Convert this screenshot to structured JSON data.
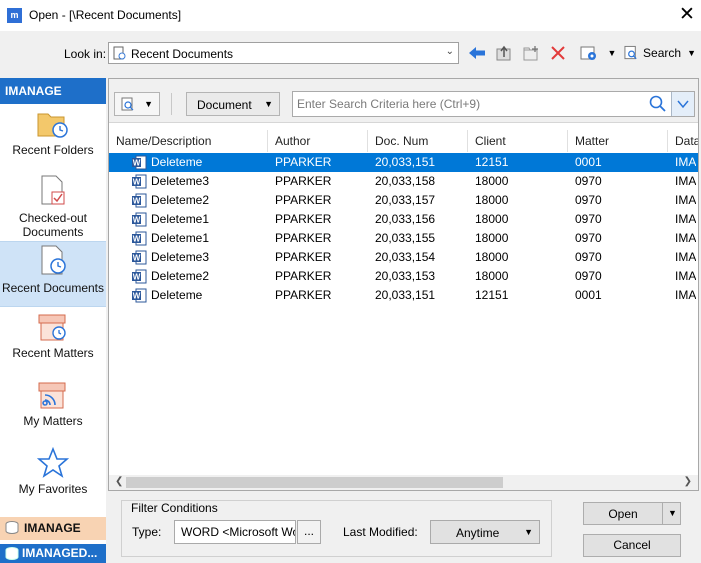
{
  "window": {
    "title": "Open - [\\Recent Documents]",
    "app_icon": "m",
    "close_glyph": "✕"
  },
  "toolbar": {
    "look_in_label": "Look in:",
    "look_in_value": "Recent Documents",
    "search_label": "Search",
    "icons": [
      "back-arrow-icon",
      "up-folder-icon",
      "new-folder-icon",
      "delete-icon",
      "settings-icon",
      "search-page-icon"
    ]
  },
  "sidebar": {
    "header": "IMANAGE",
    "items": [
      {
        "label": "Recent Folders",
        "icon": "recent-folders-icon"
      },
      {
        "label": "Checked-out Documents",
        "icon": "checked-out-icon"
      },
      {
        "label": "Recent Documents",
        "icon": "recent-documents-icon",
        "selected": true
      },
      {
        "label": "Recent Matters",
        "icon": "recent-matters-icon"
      },
      {
        "label": "My Matters",
        "icon": "my-matters-icon"
      },
      {
        "label": "My Favorites",
        "icon": "star-icon"
      }
    ],
    "footer": [
      "IMANAGE",
      "IMANAGED..."
    ]
  },
  "filterbar": {
    "doc_type": "Document",
    "search_placeholder": "Enter Search Criteria here (Ctrl+9)"
  },
  "table": {
    "columns": [
      "Name/Description",
      "Author",
      "Doc. Num",
      "Client",
      "Matter",
      "Data"
    ],
    "rows": [
      {
        "name": "Deleteme",
        "author": "PPARKER",
        "docnum": "20,033,151",
        "client": "12151",
        "matter": "0001",
        "data": "IMA"
      },
      {
        "name": "Deleteme3",
        "author": "PPARKER",
        "docnum": "20,033,158",
        "client": "18000",
        "matter": "0970",
        "data": "IMA"
      },
      {
        "name": "Deleteme2",
        "author": "PPARKER",
        "docnum": "20,033,157",
        "client": "18000",
        "matter": "0970",
        "data": "IMA"
      },
      {
        "name": "Deleteme1",
        "author": "PPARKER",
        "docnum": "20,033,156",
        "client": "18000",
        "matter": "0970",
        "data": "IMA"
      },
      {
        "name": "Deleteme1",
        "author": "PPARKER",
        "docnum": "20,033,155",
        "client": "18000",
        "matter": "0970",
        "data": "IMA"
      },
      {
        "name": "Deleteme3",
        "author": "PPARKER",
        "docnum": "20,033,154",
        "client": "18000",
        "matter": "0970",
        "data": "IMA"
      },
      {
        "name": "Deleteme2",
        "author": "PPARKER",
        "docnum": "20,033,153",
        "client": "18000",
        "matter": "0970",
        "data": "IMA"
      },
      {
        "name": "Deleteme",
        "author": "PPARKER",
        "docnum": "20,033,151",
        "client": "12151",
        "matter": "0001",
        "data": "IMA"
      }
    ],
    "selected_row": 0
  },
  "filter_conditions": {
    "title": "Filter Conditions",
    "type_label": "Type:",
    "type_value": "WORD <Microsoft Word",
    "ellipsis": "...",
    "last_modified_label": "Last Modified:",
    "last_modified_value": "Anytime"
  },
  "buttons": {
    "open": "Open",
    "cancel": "Cancel"
  },
  "colors": {
    "accent": "#0078d7",
    "sidebar_header": "#1e6fc9",
    "selected_side": "#cfe3f7",
    "footer_orange": "#f8d3b3"
  }
}
